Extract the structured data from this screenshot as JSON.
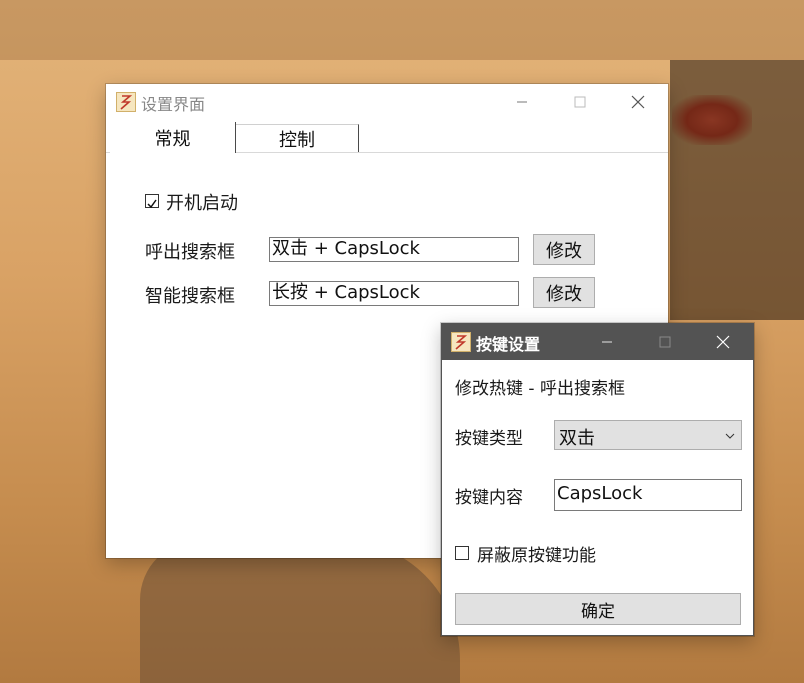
{
  "main_window": {
    "title": "设置界面",
    "tabs": [
      {
        "label": "常规",
        "selected": true
      },
      {
        "label": "控制",
        "selected": false
      }
    ],
    "autostart": {
      "label": "开机启动",
      "checked": true
    },
    "rows": [
      {
        "label": "呼出搜索框",
        "value": "双击 + CapsLock",
        "button": "修改"
      },
      {
        "label": "智能搜索框",
        "value": "长按 + CapsLock",
        "button": "修改"
      }
    ]
  },
  "dialog": {
    "title": "按键设置",
    "heading": "修改热键 - 呼出搜索框",
    "key_type_label": "按键类型",
    "key_type_value": "双击",
    "key_content_label": "按键内容",
    "key_content_value": "CapsLock",
    "block_original": {
      "label": "屏蔽原按键功能",
      "checked": false
    },
    "confirm_button": "确定"
  },
  "colors": {
    "dialog_titlebar": "#535353",
    "accent_red": "#e0452c"
  }
}
